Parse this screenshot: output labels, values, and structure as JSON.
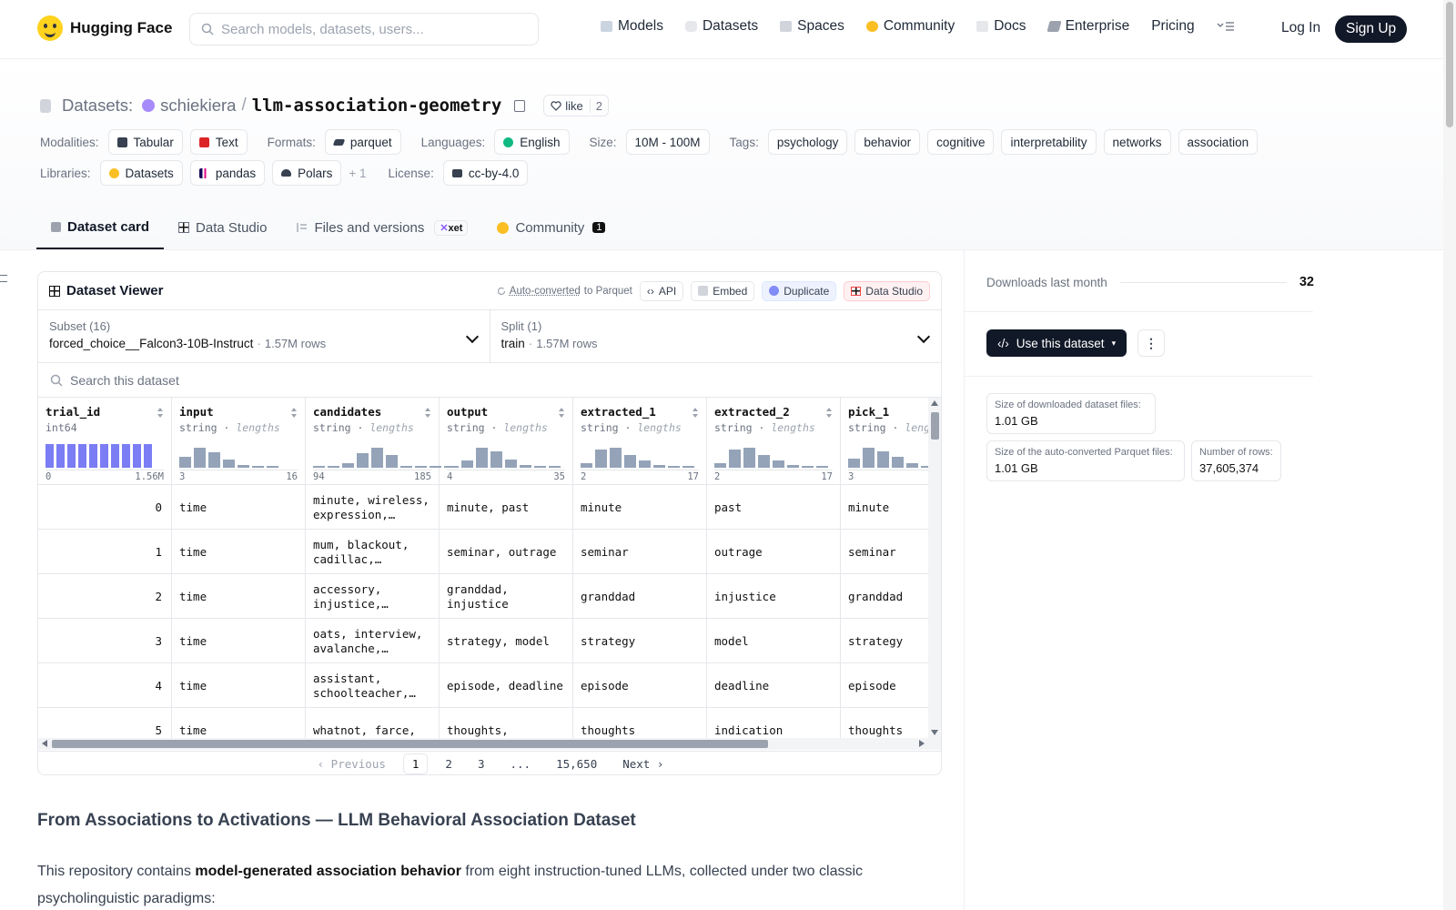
{
  "colors": {
    "accent": "#111827",
    "hf_yellow": "#ffd21e",
    "histogram": "#94a3b8",
    "histogram_int": "#6366f1"
  },
  "nav": {
    "brand": "Hugging Face",
    "search_placeholder": "Search models, datasets, users...",
    "links": [
      {
        "label": "Models",
        "icon": "models-icon"
      },
      {
        "label": "Datasets",
        "icon": "datasets-icon"
      },
      {
        "label": "Spaces",
        "icon": "spaces-icon"
      },
      {
        "label": "Community",
        "icon": "community-icon"
      },
      {
        "label": "Docs",
        "icon": "docs-icon"
      },
      {
        "label": "Enterprise",
        "icon": "enterprise-icon"
      },
      {
        "label": "Pricing",
        "icon": ""
      }
    ],
    "login": "Log In",
    "signup": "Sign Up"
  },
  "repo": {
    "kind": "Datasets:",
    "owner": "schiekiera",
    "sep": "/",
    "name": "llm-association-geometry",
    "like_label": "like",
    "like_count": "2"
  },
  "tags": {
    "modalities_label": "Modalities:",
    "modalities": [
      "Tabular",
      "Text"
    ],
    "formats_label": "Formats:",
    "formats": [
      "parquet"
    ],
    "languages_label": "Languages:",
    "languages": [
      "English"
    ],
    "size_label": "Size:",
    "size": "10M - 100M",
    "tags_label": "Tags:",
    "tags": [
      "psychology",
      "behavior",
      "cognitive",
      "interpretability",
      "networks",
      "association"
    ],
    "libraries_label": "Libraries:",
    "libraries": [
      "Datasets",
      "pandas",
      "Polars"
    ],
    "libraries_more": "+ 1",
    "license_label": "License:",
    "license": "cc-by-4.0"
  },
  "tabs": [
    {
      "label": "Dataset card",
      "active": true
    },
    {
      "label": "Data Studio",
      "active": false
    },
    {
      "label": "Files and versions",
      "active": false,
      "badge": "xet"
    },
    {
      "label": "Community",
      "active": false,
      "count": "1"
    }
  ],
  "viewer": {
    "title": "Dataset Viewer",
    "auto_converted_link": "Auto-converted",
    "auto_converted_rest": "to Parquet",
    "actions": [
      "API",
      "Embed",
      "Duplicate",
      "Data Studio"
    ],
    "subset_label": "Subset (16)",
    "subset_value": "forced_choice__Falcon3-10B-Instruct",
    "subset_rows": "1.57M rows",
    "split_label": "Split (1)",
    "split_value": "train",
    "split_rows": "1.57M rows",
    "search_placeholder": "Search this dataset",
    "columns": [
      {
        "name": "trial_id",
        "type": "int64",
        "extra": "",
        "min": "0",
        "max": "1.56M",
        "hist": [
          1,
          1,
          1,
          1,
          1,
          1,
          1,
          1,
          1,
          1
        ],
        "kind": "int"
      },
      {
        "name": "input",
        "type": "string",
        "extra": "lengths",
        "min": "3",
        "max": "16",
        "hist": [
          0.45,
          0.85,
          0.65,
          0.35,
          0.12,
          0.06,
          0.03
        ],
        "kind": "str"
      },
      {
        "name": "candidates",
        "type": "string",
        "extra": "lengths",
        "min": "94",
        "max": "185",
        "hist": [
          0.03,
          0.06,
          0.2,
          0.6,
          0.85,
          0.55,
          0.08,
          0.04,
          0.03,
          0.02
        ],
        "kind": "str"
      },
      {
        "name": "output",
        "type": "string",
        "extra": "lengths",
        "min": "4",
        "max": "35",
        "hist": [
          0.05,
          0.3,
          0.85,
          0.7,
          0.35,
          0.1,
          0.05,
          0.03
        ],
        "kind": "str"
      },
      {
        "name": "extracted_1",
        "type": "string",
        "extra": "lengths",
        "min": "2",
        "max": "17",
        "hist": [
          0.2,
          0.75,
          0.85,
          0.55,
          0.3,
          0.1,
          0.05,
          0.03
        ],
        "kind": "str"
      },
      {
        "name": "extracted_2",
        "type": "string",
        "extra": "lengths",
        "min": "2",
        "max": "17",
        "hist": [
          0.2,
          0.75,
          0.85,
          0.55,
          0.3,
          0.1,
          0.05,
          0.03
        ],
        "kind": "str"
      },
      {
        "name": "pick_1",
        "type": "string",
        "extra": "lengths",
        "min": "3",
        "max": "",
        "hist": [
          0.4,
          0.85,
          0.7,
          0.45,
          0.2,
          0.08
        ],
        "kind": "str"
      }
    ],
    "rows": [
      {
        "trial_id": "0",
        "input": "time",
        "candidates": "minute, wireless, expression,…",
        "output": "minute, past",
        "extracted_1": "minute",
        "extracted_2": "past",
        "pick_1": "minute"
      },
      {
        "trial_id": "1",
        "input": "time",
        "candidates": "mum, blackout, cadillac,…",
        "output": "seminar, outrage",
        "extracted_1": "seminar",
        "extracted_2": "outrage",
        "pick_1": "seminar"
      },
      {
        "trial_id": "2",
        "input": "time",
        "candidates": "accessory, injustice,…",
        "output": "granddad, injustice",
        "extracted_1": "granddad",
        "extracted_2": "injustice",
        "pick_1": "granddad"
      },
      {
        "trial_id": "3",
        "input": "time",
        "candidates": "oats, interview, avalanche,…",
        "output": "strategy, model",
        "extracted_1": "strategy",
        "extracted_2": "model",
        "pick_1": "strategy"
      },
      {
        "trial_id": "4",
        "input": "time",
        "candidates": "assistant, schoolteacher,…",
        "output": "episode, deadline",
        "extracted_1": "episode",
        "extracted_2": "deadline",
        "pick_1": "episode"
      },
      {
        "trial_id": "5",
        "input": "time",
        "candidates": "whatnot, farce,",
        "output": "thoughts,",
        "extracted_1": "thoughts",
        "extracted_2": "indication",
        "pick_1": "thoughts"
      }
    ],
    "pager": {
      "previous": "Previous",
      "pages": [
        "1",
        "2",
        "3",
        "...",
        "15,650"
      ],
      "next": "Next"
    }
  },
  "sidebar": {
    "downloads_label": "Downloads last month",
    "downloads_value": "32",
    "use_dataset": "Use this dataset",
    "stats": [
      {
        "label": "Size of downloaded dataset files:",
        "value": "1.01 GB"
      },
      {
        "label": "Size of the auto-converted Parquet files:",
        "value": "1.01 GB"
      },
      {
        "label": "Number of rows:",
        "value": "37,605,374"
      }
    ]
  },
  "article": {
    "heading": "From Associations to Activations — LLM Behavioral Association Dataset",
    "p1_before": "This repository contains ",
    "p1_bold": "model-generated association behavior",
    "p1_after": " from eight instruction-tuned LLMs, collected under two classic psycholinguistic paradigms:"
  }
}
